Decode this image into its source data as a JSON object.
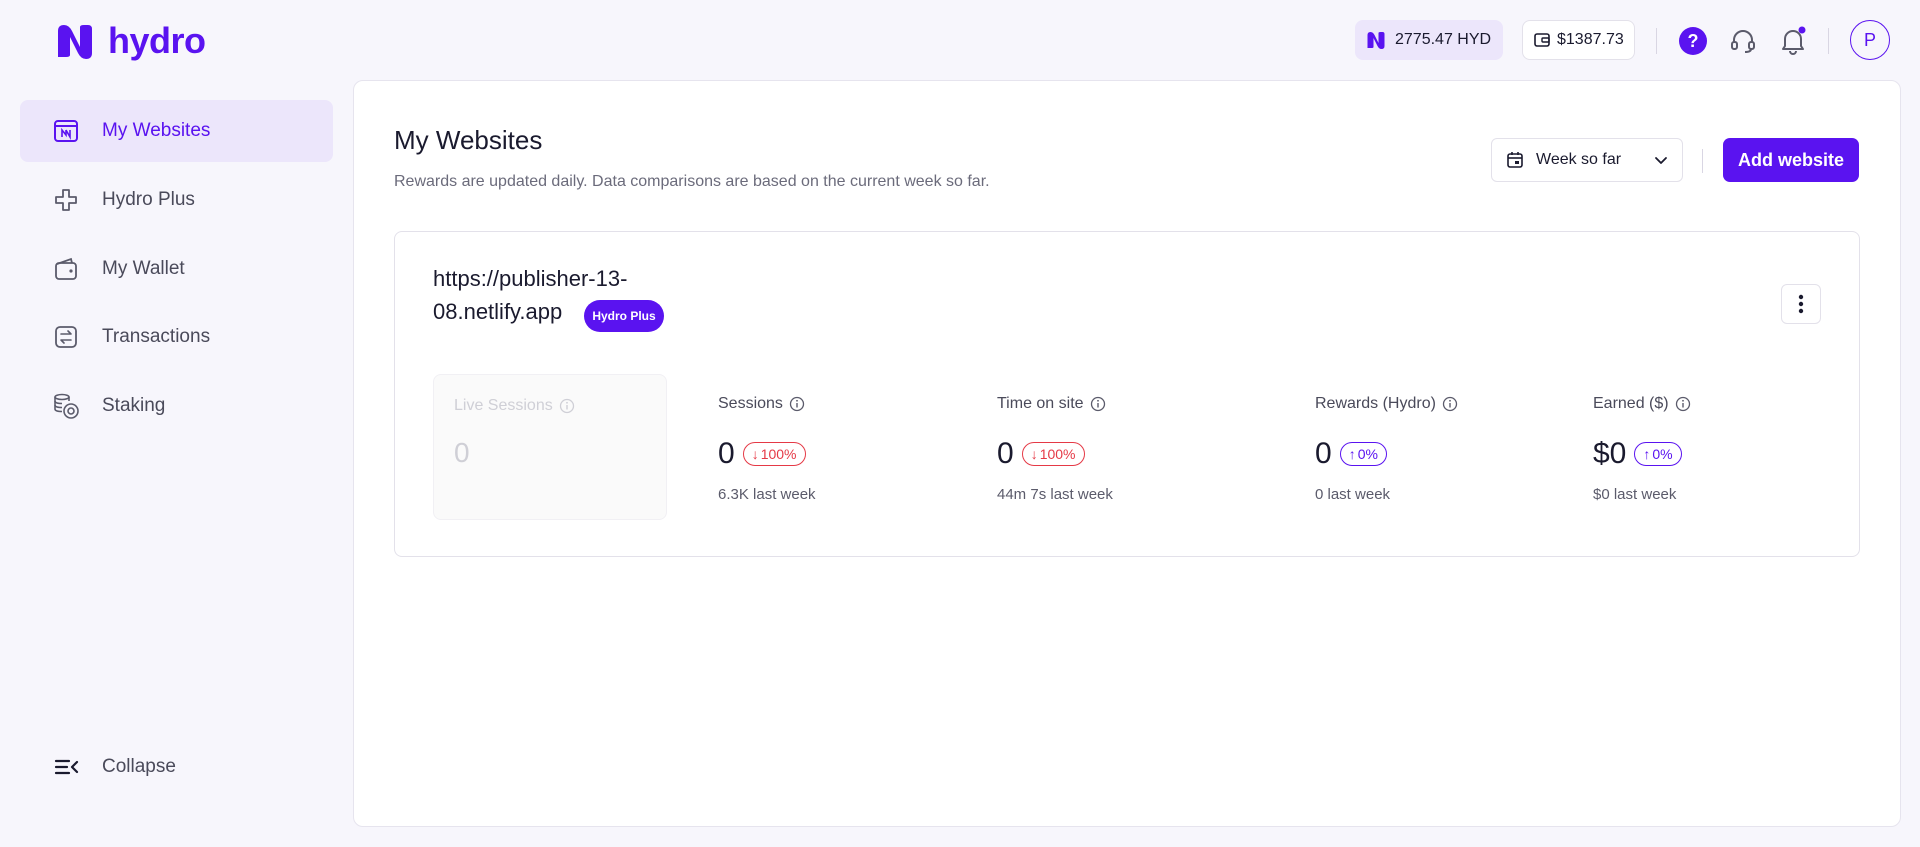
{
  "app": {
    "brand": "hydro",
    "accent": "#5a13f0"
  },
  "header": {
    "hyd_balance": "2775.47 HYD",
    "usd_balance": "$1387.73",
    "help_icon": "question-icon",
    "support_icon": "headset-icon",
    "notification_icon": "bell-icon",
    "avatar_initial": "P"
  },
  "sidebar": {
    "items": [
      {
        "label": "My Websites",
        "icon": "website-icon",
        "active": true
      },
      {
        "label": "Hydro Plus",
        "icon": "plus-icon",
        "active": false
      },
      {
        "label": "My Wallet",
        "icon": "wallet-icon",
        "active": false
      },
      {
        "label": "Transactions",
        "icon": "transactions-icon",
        "active": false
      },
      {
        "label": "Staking",
        "icon": "staking-icon",
        "active": false
      }
    ],
    "collapse_label": "Collapse"
  },
  "main": {
    "title": "My Websites",
    "subtitle": "Rewards are updated daily. Data comparisons are based on the current week so far.",
    "period_select": "Week so far",
    "add_button": "Add website"
  },
  "site": {
    "url_line1": "https://publisher-13-",
    "url_line2": "08.netlify.app",
    "badge": "Hydro Plus",
    "live_sessions": {
      "label": "Live Sessions",
      "value": "0"
    },
    "stats": [
      {
        "label": "Sessions",
        "value": "0",
        "delta": "100%",
        "direction": "down",
        "sub": "6.3K last week"
      },
      {
        "label": "Time on site",
        "value": "0",
        "delta": "100%",
        "direction": "down",
        "sub": "44m 7s last week"
      },
      {
        "label": "Rewards (Hydro)",
        "value": "0",
        "delta": "0%",
        "direction": "up",
        "sub": "0 last week"
      },
      {
        "label": "Earned ($)",
        "value": "$0",
        "delta": "0%",
        "direction": "up",
        "sub": "$0 last week"
      }
    ]
  }
}
